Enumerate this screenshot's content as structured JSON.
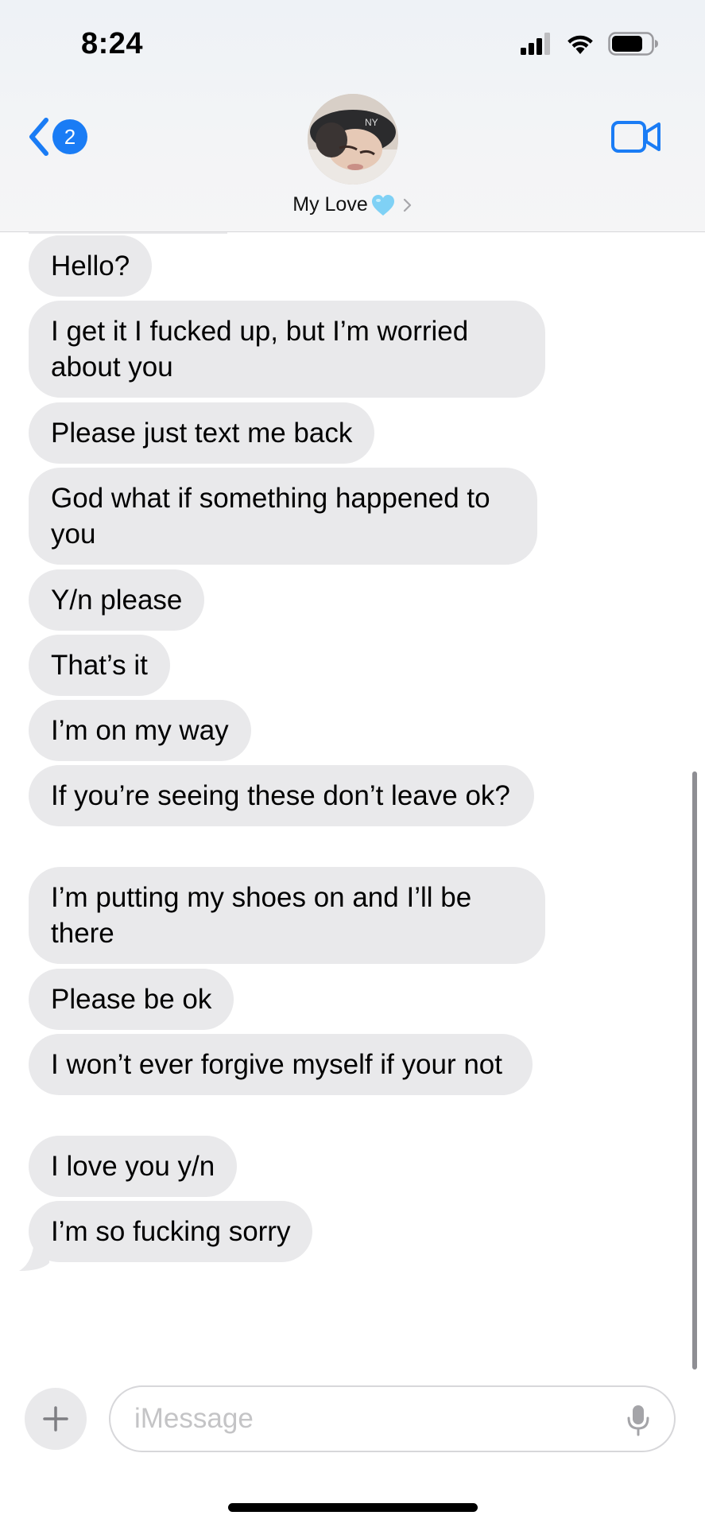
{
  "status_bar": {
    "time": "8:24",
    "signal_icon": "cellular-signal-icon",
    "wifi_icon": "wifi-icon",
    "battery_icon": "battery-icon"
  },
  "header": {
    "back_badge": "2",
    "back_icon": "chevron-left-icon",
    "contact_name": "My Love",
    "contact_emoji_icon": "light-blue-heart-icon",
    "facetime_icon": "video-camera-icon"
  },
  "messages": [
    {
      "text": "Hello?",
      "direction": "incoming"
    },
    {
      "text": "I get it I fucked up, but I’m worried about you",
      "direction": "incoming"
    },
    {
      "text": "Please just text me back",
      "direction": "incoming"
    },
    {
      "text": "God what if something happened to you",
      "direction": "incoming"
    },
    {
      "text": "Y/n please",
      "direction": "incoming"
    },
    {
      "text": "That’s it",
      "direction": "incoming"
    },
    {
      "text": "I’m on my way",
      "direction": "incoming"
    },
    {
      "text": "If you’re seeing these don’t leave ok?",
      "direction": "incoming"
    },
    {
      "text": "I’m putting my shoes on and I’ll be there",
      "direction": "incoming"
    },
    {
      "text": "Please be ok",
      "direction": "incoming"
    },
    {
      "text": "I won’t ever forgive myself if your not",
      "direction": "incoming"
    },
    {
      "text": "I love you y/n",
      "direction": "incoming"
    },
    {
      "text": "I’m so fucking sorry",
      "direction": "incoming"
    }
  ],
  "compose": {
    "placeholder": "iMessage",
    "value": "",
    "plus_icon": "plus-icon",
    "mic_icon": "microphone-icon"
  },
  "colors": {
    "accent": "#1a7cf5",
    "incoming_bubble": "#e9e9eb",
    "heart": "#7fd1f5"
  }
}
